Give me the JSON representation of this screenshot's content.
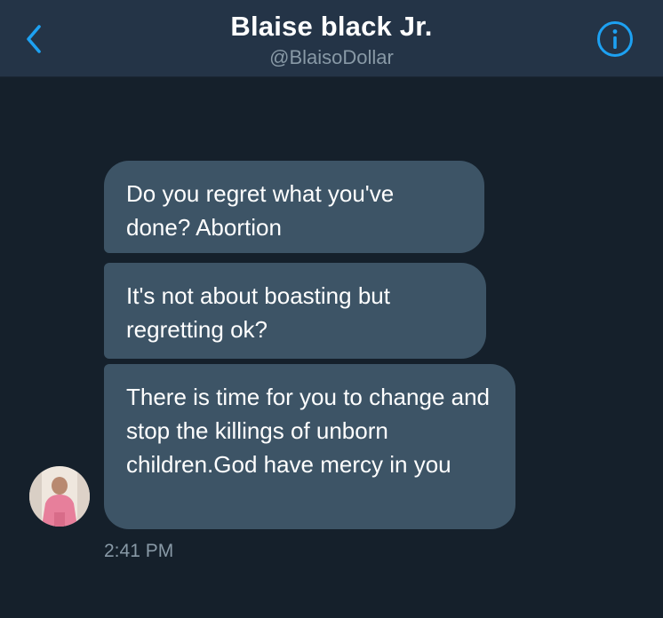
{
  "header": {
    "title": "Blaise black Jr.",
    "handle": "@BlaisoDollar",
    "back_icon": "chevron-left-icon",
    "info_icon": "info-icon",
    "accent_color": "#1da1f2"
  },
  "messages": [
    {
      "text": "Do you regret what you've done? Abortion"
    },
    {
      "text": "It's not about boasting but regretting ok?"
    },
    {
      "text": "There is time for you to change and stop  the killings of unborn children.God have mercy in you"
    }
  ],
  "timestamp": "2:41 PM",
  "colors": {
    "background": "#15202b",
    "header_background": "#243447",
    "bubble": "#3d5466",
    "muted_text": "#8899a6"
  }
}
